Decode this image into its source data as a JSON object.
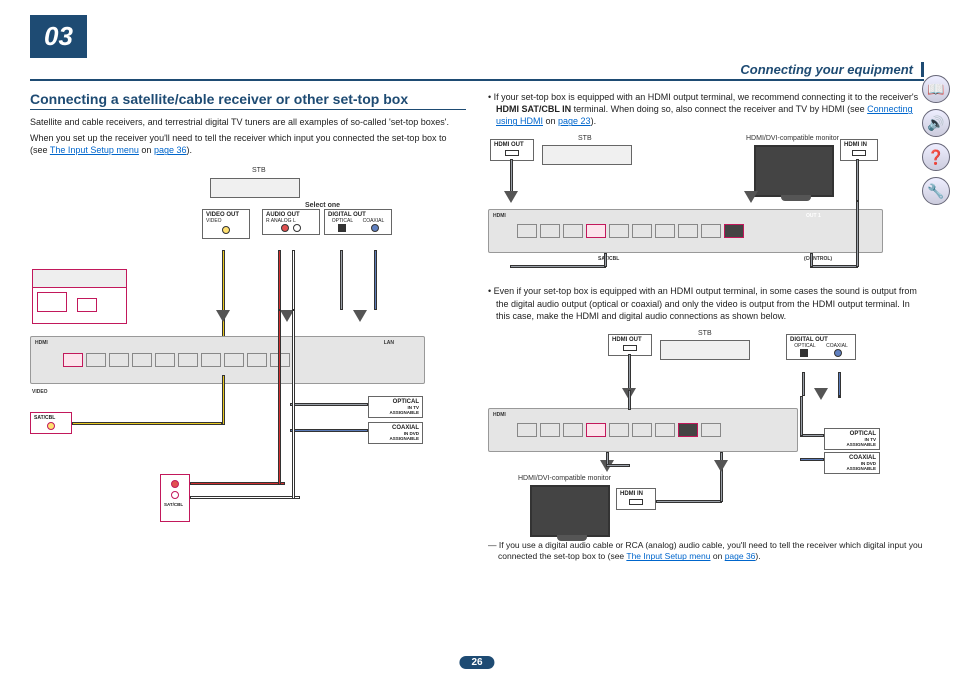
{
  "chapter_number": "03",
  "header_title": "Connecting your equipment",
  "page_number": "26",
  "left": {
    "section_title": "Connecting a satellite/cable receiver or other set-top box",
    "para1_a": "Satellite and cable receivers, and terrestrial digital TV tuners are all examples of so-called 'set-top boxes'.",
    "para1_b": "When you set up the receiver you'll need to tell the receiver which input you connected the set-top box to (see ",
    "link1_text": "The Input Setup menu",
    "para1_c": " on ",
    "link1_page": "page 36",
    "para1_d": ")."
  },
  "right": {
    "bullet1_a": "If your set-top box is equipped with an HDMI output terminal, we recommend connecting it to the receiver's ",
    "bullet1_bold": "HDMI SAT/CBL IN",
    "bullet1_b": " terminal. When doing so, also connect the receiver and TV by HDMI (see ",
    "bullet1_link": "Connecting using HDMI",
    "bullet1_c": " on ",
    "bullet1_page": "page 23",
    "bullet1_d": ").",
    "bullet2": "Even if your set-top box is equipped with an HDMI output terminal, in some cases the sound is output from the digital audio output (optical or coaxial) and only the video is output from the HDMI output terminal. In this case, make the HDMI and digital audio connections as shown below.",
    "note_a": "— If you use a digital audio cable or RCA (analog) audio cable, you'll need to tell the receiver which digital input you connected the set-top box to (see ",
    "note_link": "The Input Setup menu",
    "note_b": " on ",
    "note_page": "page 36",
    "note_c": ")."
  },
  "labels": {
    "stb": "STB",
    "select_one": "Select one",
    "video_out": "VIDEO OUT",
    "video": "VIDEO",
    "audio_out": "AUDIO OUT",
    "analog_lr": "R  ANALOG  L",
    "digital_out": "DIGITAL OUT",
    "optical": "OPTICAL",
    "coaxial": "COAXIAL",
    "hdmi": "HDMI",
    "hdmi_out": "HDMI OUT",
    "hdmi_in": "HDMI IN",
    "monitor": "HDMI/DVI-compatible monitor",
    "assignable": "ASSIGNABLE",
    "sat_cbl": "SAT/CBL",
    "lan": "LAN",
    "out1": "OUT 1",
    "control": "(CONTROL)",
    "in_tv": "IN  TV",
    "in_dvd": "IN  DVD"
  },
  "sidebar": {
    "book": "📖",
    "speaker": "🔊",
    "help": "❓",
    "tools": "🔧"
  }
}
